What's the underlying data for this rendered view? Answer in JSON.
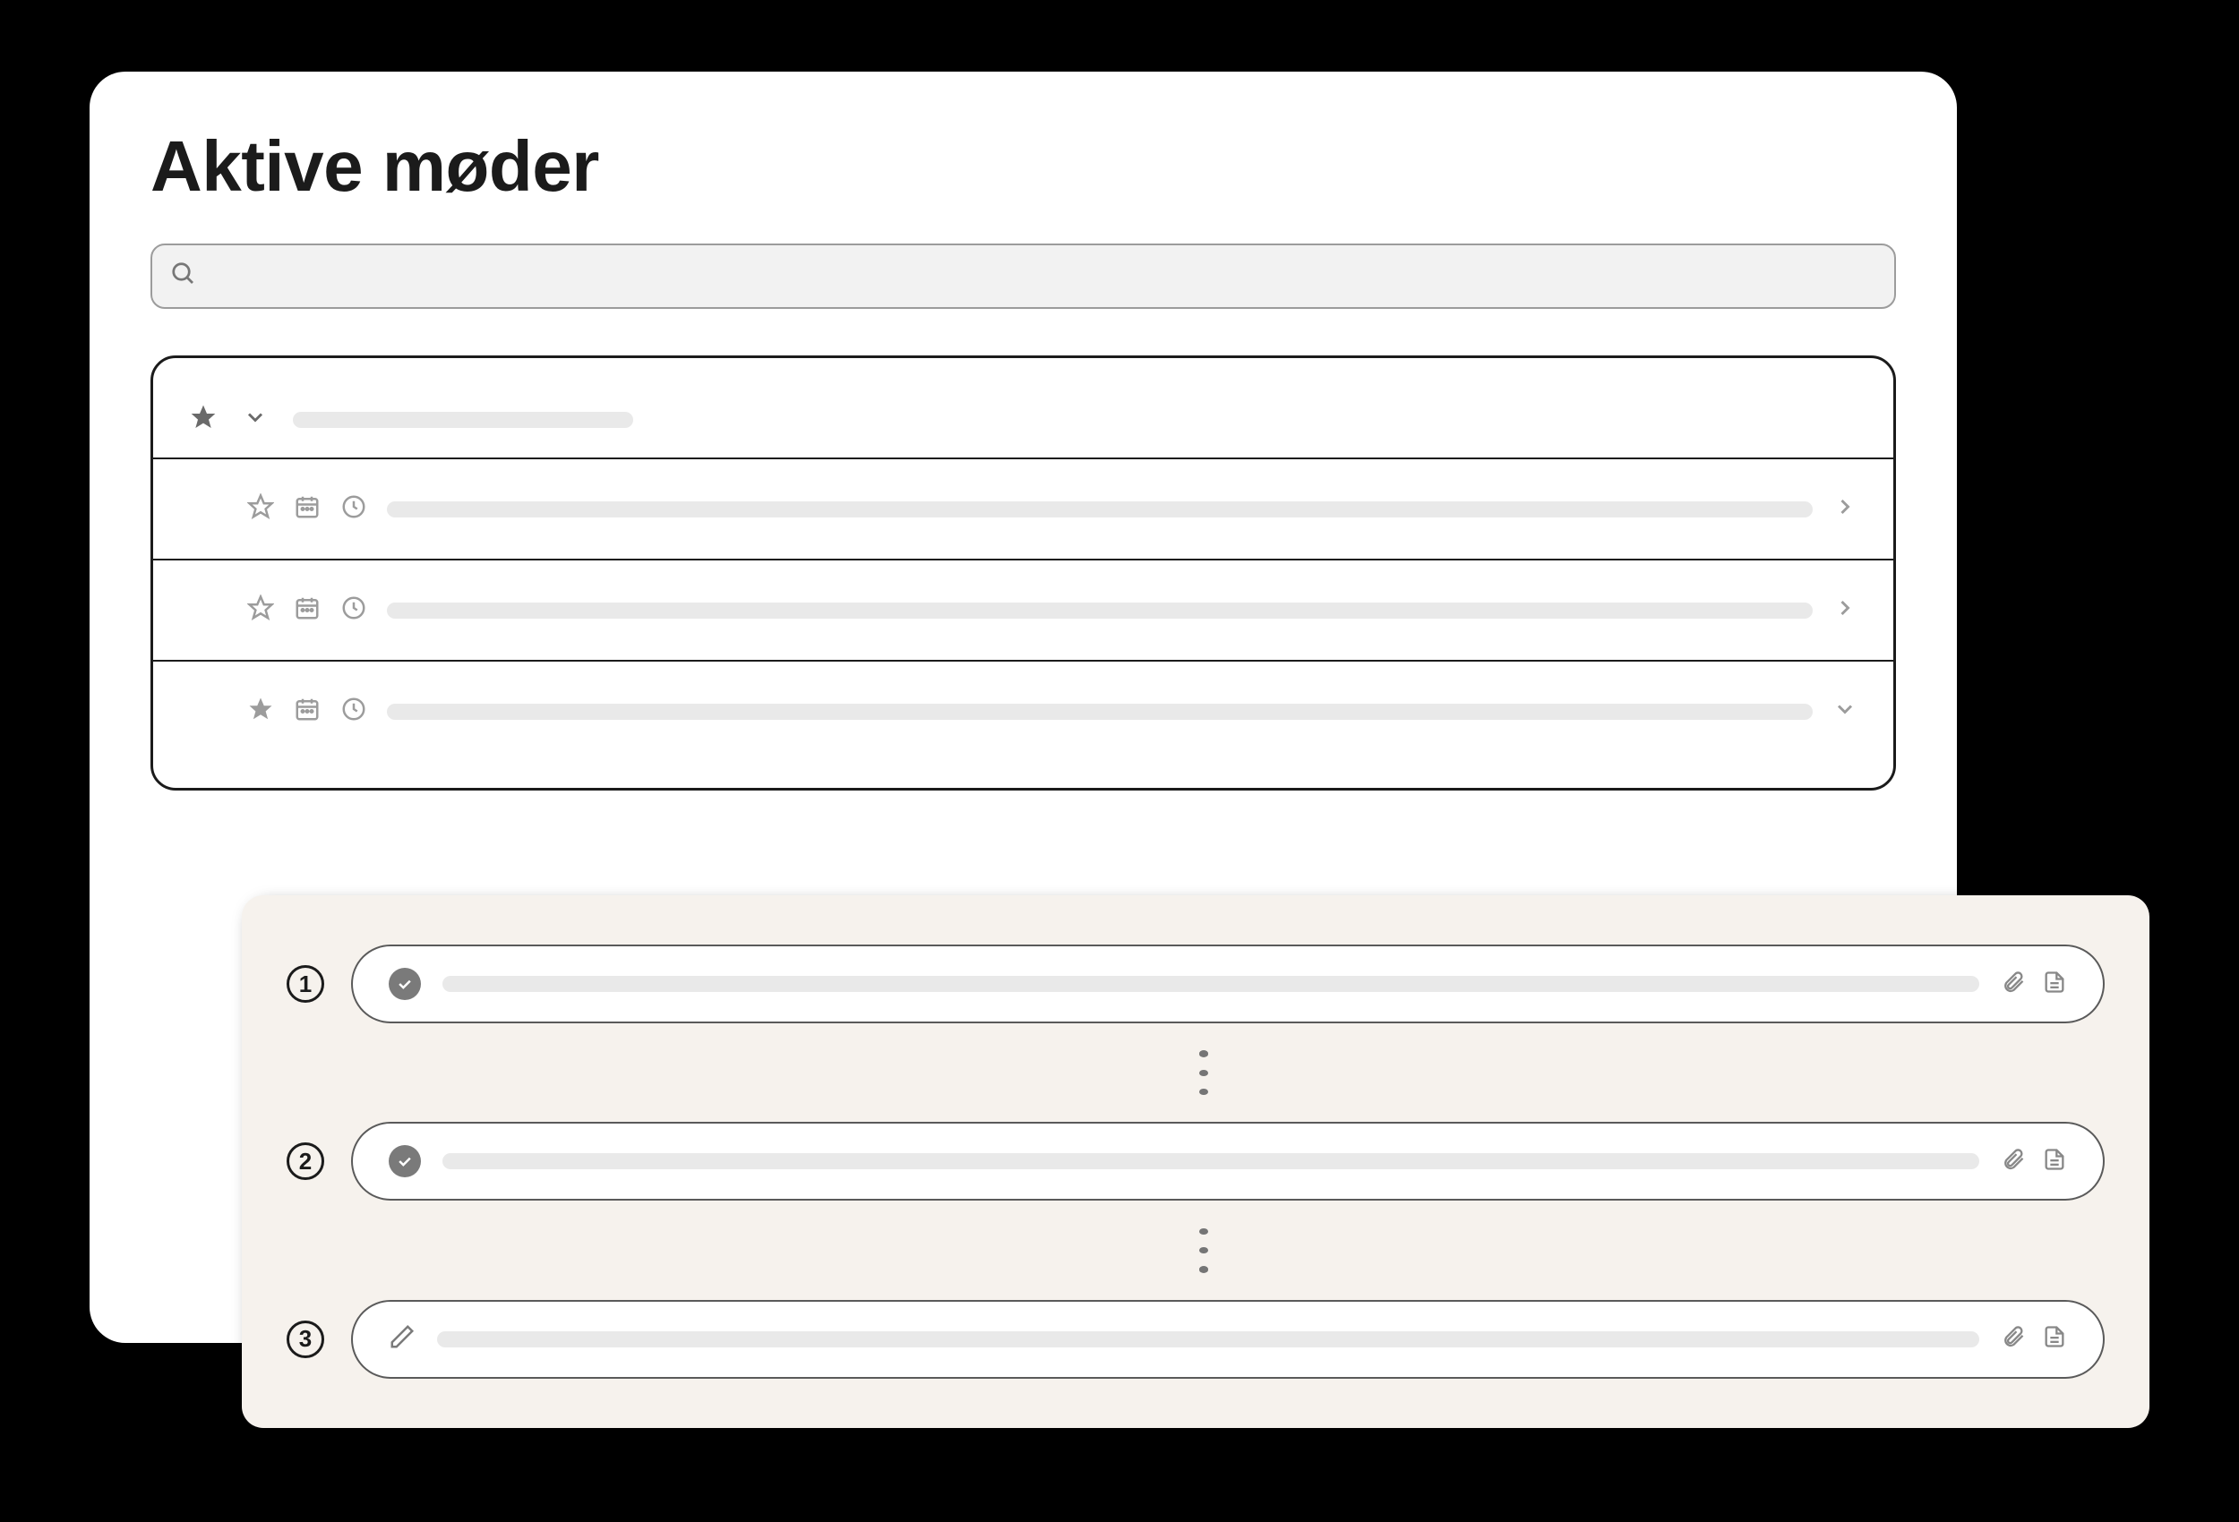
{
  "page_title": "Aktive møder",
  "search": {
    "placeholder": ""
  },
  "group": {
    "expanded": true
  },
  "meetings": [
    {
      "starred": false,
      "expanded": false
    },
    {
      "starred": false,
      "expanded": false
    },
    {
      "starred": true,
      "expanded": true
    }
  ],
  "agenda": {
    "steps": [
      {
        "number": "1",
        "status": "done"
      },
      {
        "number": "2",
        "status": "done"
      },
      {
        "number": "3",
        "status": "editing"
      }
    ]
  }
}
